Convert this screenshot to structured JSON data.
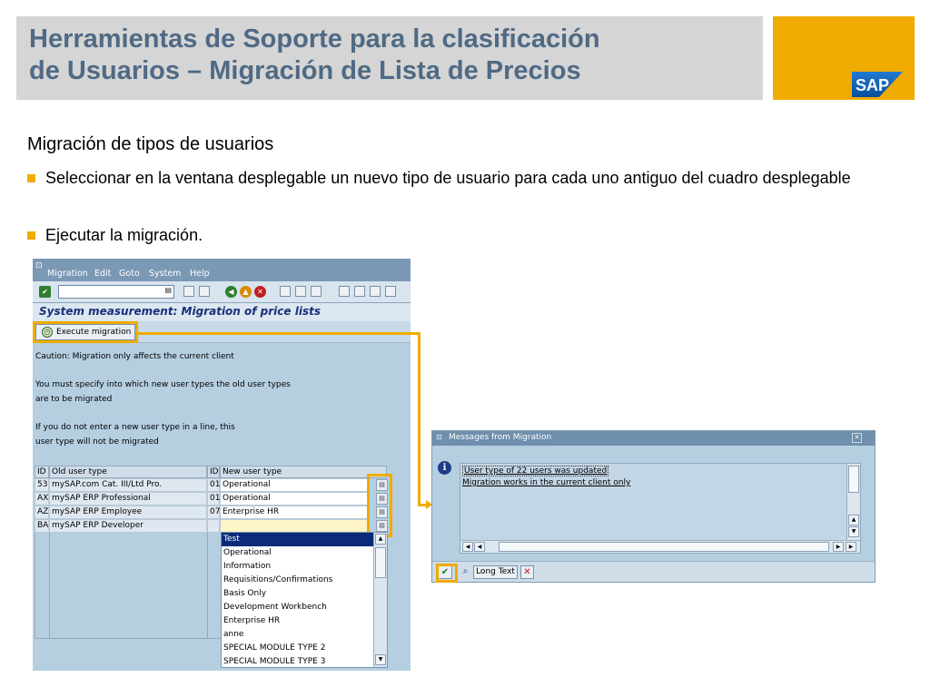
{
  "slide": {
    "title_line1": "Herramientas de Soporte para la clasificación",
    "title_line2": "de Usuarios – Migración de Lista de Precios",
    "logo_text": "SAP",
    "heading": "Migración de tipos de usuarios",
    "bullets": [
      "Seleccionar en la ventana desplegable un nuevo tipo de usuario para cada uno antiguo del cuadro desplegable",
      "Ejecutar la migración."
    ],
    "colors": {
      "title": "#4f6a84",
      "accent": "#f0ab00",
      "title_bg": "#d5d5d5"
    }
  },
  "window1": {
    "menu": [
      "Migration",
      "Edit",
      "Goto",
      "System",
      "Help"
    ],
    "title": "System measurement: Migration of price lists",
    "execute_button": "Execute migration",
    "messages": [
      "Caution: Migration only affects the current client",
      "You must specify into which new user types the old user types",
      "are to be migrated",
      "If you do not enter a new user type in a line, this",
      "user type will not be migrated"
    ],
    "table": {
      "headers": [
        "ID",
        "Old user type",
        "ID",
        "New user type"
      ],
      "rows": [
        {
          "id_old": "53",
          "old_type": "mySAP.com Cat. III/Ltd Pro.",
          "id_new": "01",
          "new_type": "Operational"
        },
        {
          "id_old": "AX",
          "old_type": "mySAP ERP Professional",
          "id_new": "01",
          "new_type": "Operational"
        },
        {
          "id_old": "AZ",
          "old_type": "mySAP ERP Employee",
          "id_new": "07",
          "new_type": "Enterprise HR"
        },
        {
          "id_old": "BA",
          "old_type": "mySAP ERP Developer",
          "id_new": "",
          "new_type": ""
        }
      ]
    },
    "dropdown_options": [
      "Test",
      "Operational",
      "Information",
      "Requisitions/Confirmations",
      "Basis Only",
      "Development Workbench",
      "Enterprise HR",
      "anne",
      "SPECIAL MODULE TYPE 2",
      "SPECIAL MODULE TYPE 3"
    ],
    "dropdown_selected": "Test"
  },
  "window2": {
    "title": "Messages from Migration",
    "messages": [
      "User type of 22 users was updated",
      "Migration works in the current client only"
    ],
    "long_text_button": "Long Text"
  }
}
